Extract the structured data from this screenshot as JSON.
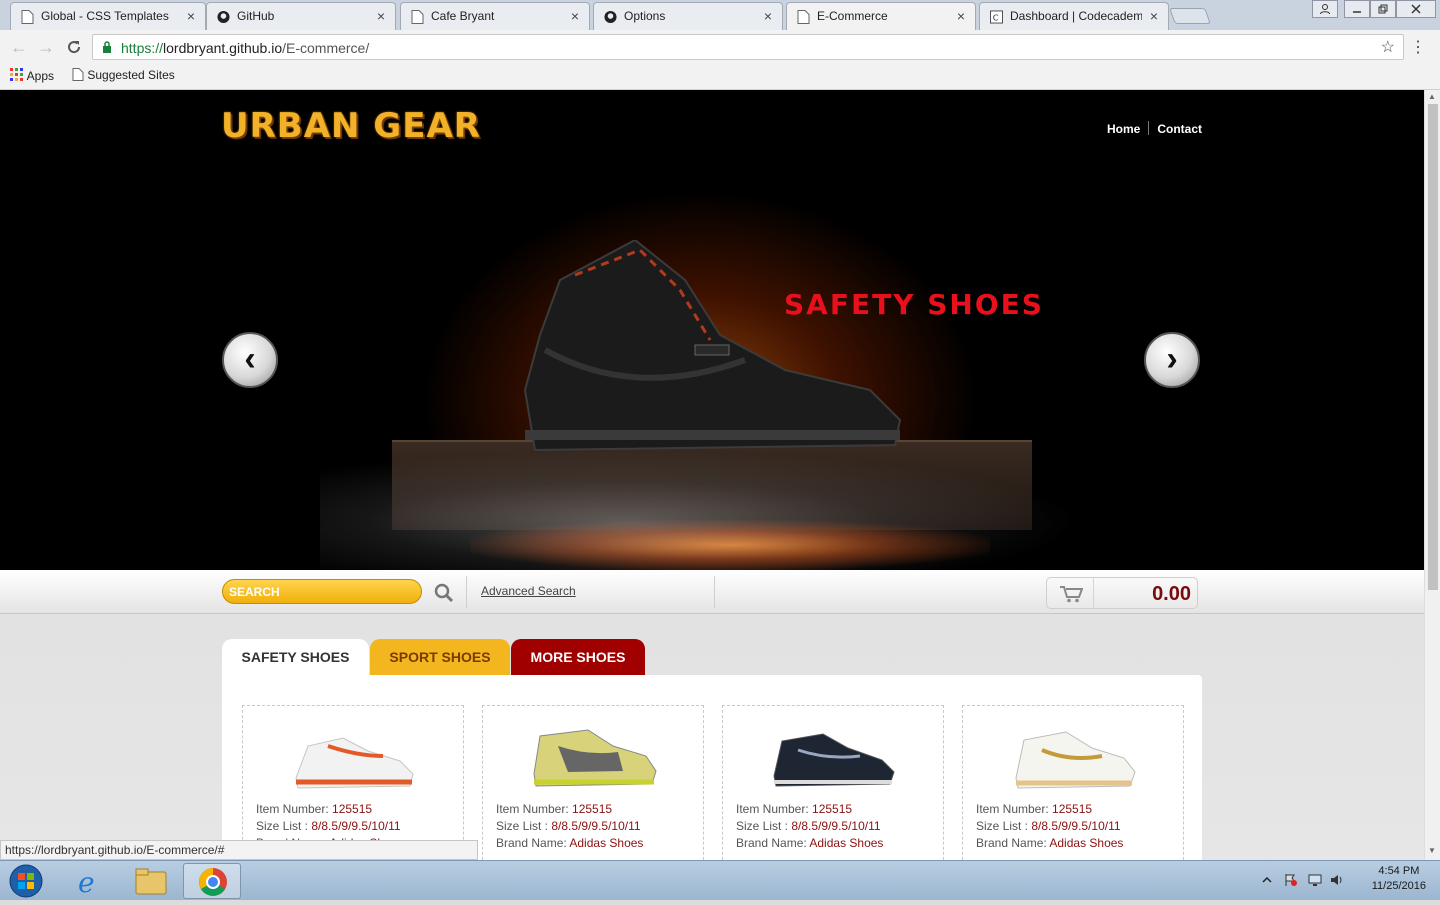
{
  "browser": {
    "tabs": [
      {
        "title": "Global - CSS Templates",
        "active": false,
        "icon": "page-icon"
      },
      {
        "title": "GitHub",
        "active": false,
        "icon": "github-icon"
      },
      {
        "title": "Cafe Bryant",
        "active": false,
        "icon": "page-icon"
      },
      {
        "title": "Options",
        "active": false,
        "icon": "github-icon"
      },
      {
        "title": "E-Commerce",
        "active": true,
        "icon": "page-icon"
      },
      {
        "title": "Dashboard | Codecadem",
        "active": false,
        "icon": "codecademy-icon"
      }
    ],
    "tab_close": "×",
    "url_scheme": "https://",
    "url_host": "lordbryant.github.io",
    "url_path": "/E-commerce/",
    "bookmarks": [
      {
        "label": "Apps",
        "icon": "apps-grid-icon"
      },
      {
        "label": "Suggested Sites",
        "icon": "page-icon"
      }
    ],
    "status_url": "https://lordbryant.github.io/E-commerce/#"
  },
  "site": {
    "logo": "URBAN GEAR",
    "nav": [
      {
        "label": "Home"
      },
      {
        "label": "Contact"
      }
    ],
    "hero_caption": "SAFETY SHOES",
    "colors": {
      "accent_yellow": "#f3b61f",
      "accent_red": "#a00000",
      "caption_red": "#e8101a"
    }
  },
  "search": {
    "placeholder": "SEARCH",
    "advanced_label": "Advanced Search",
    "cart_total": "0.00"
  },
  "tabs": [
    {
      "label": "SAFETY SHOES",
      "active": true
    },
    {
      "label": "SPORT SHOES",
      "active": false
    },
    {
      "label": "MORE SHOES",
      "active": false
    }
  ],
  "products": [
    {
      "item_label": "Item Number:",
      "item_number": "125515",
      "size_label": "Size List :",
      "sizes": "8/8.5/9/9.5/10/11",
      "brand_label": "Brand Name:",
      "brand": "Adidas Shoes",
      "shoe_color": "white-red"
    },
    {
      "item_label": "Item Number:",
      "item_number": "125515",
      "size_label": "Size List :",
      "sizes": "8/8.5/9/9.5/10/11",
      "brand_label": "Brand Name:",
      "brand": "Adidas Shoes",
      "shoe_color": "yellow-grey"
    },
    {
      "item_label": "Item Number:",
      "item_number": "125515",
      "size_label": "Size List :",
      "sizes": "8/8.5/9/9.5/10/11",
      "brand_label": "Brand Name:",
      "brand": "Adidas Shoes",
      "shoe_color": "navy"
    },
    {
      "item_label": "Item Number:",
      "item_number": "125515",
      "size_label": "Size List :",
      "sizes": "8/8.5/9/9.5/10/11",
      "brand_label": "Brand Name:",
      "brand": "Adidas Shoes",
      "shoe_color": "white-gold"
    }
  ],
  "taskbar": {
    "time": "4:54 PM",
    "date": "11/25/2016"
  }
}
